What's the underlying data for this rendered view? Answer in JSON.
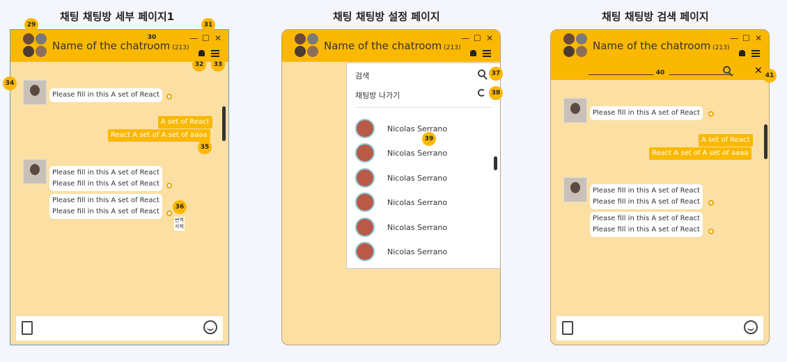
{
  "frames": {
    "f1": {
      "title": "채팅 채팅방 세부 페이지1"
    },
    "f2": {
      "title": "채팅 채팅방 설정 페이지"
    },
    "f3": {
      "title": "채팅 채팅방 검색 페이지"
    }
  },
  "header": {
    "room_name": "Name of the chatroom",
    "member_count": "(213)"
  },
  "window_controls": {
    "minimize": "—",
    "maximize": "☐",
    "close": "✕"
  },
  "badges": [
    "29",
    "30",
    "31",
    "32",
    "33",
    "34",
    "35",
    "36",
    "37",
    "38",
    "39",
    "40",
    "41"
  ],
  "messages": {
    "other_single": "Please fill in this  A set of React",
    "mine_1": "A set of React",
    "mine_2": "React A set of A set of aaaa",
    "other_line": "Please fill in this  A set of React"
  },
  "context_menu": {
    "line1": "번역",
    "line2": "삭제"
  },
  "settings_panel": {
    "search_label": "검색",
    "leave_label": "채팅방 나가기",
    "members": [
      "Nicolas Serrano",
      "Nicolas Serrano",
      "Nicolas Serrano",
      "Nicolas Serrano",
      "Nicolas Serrano",
      "Nicolas Serrano"
    ]
  },
  "colors": {
    "accent": "#fbb800",
    "chat_bg": "#fbdfa3"
  }
}
